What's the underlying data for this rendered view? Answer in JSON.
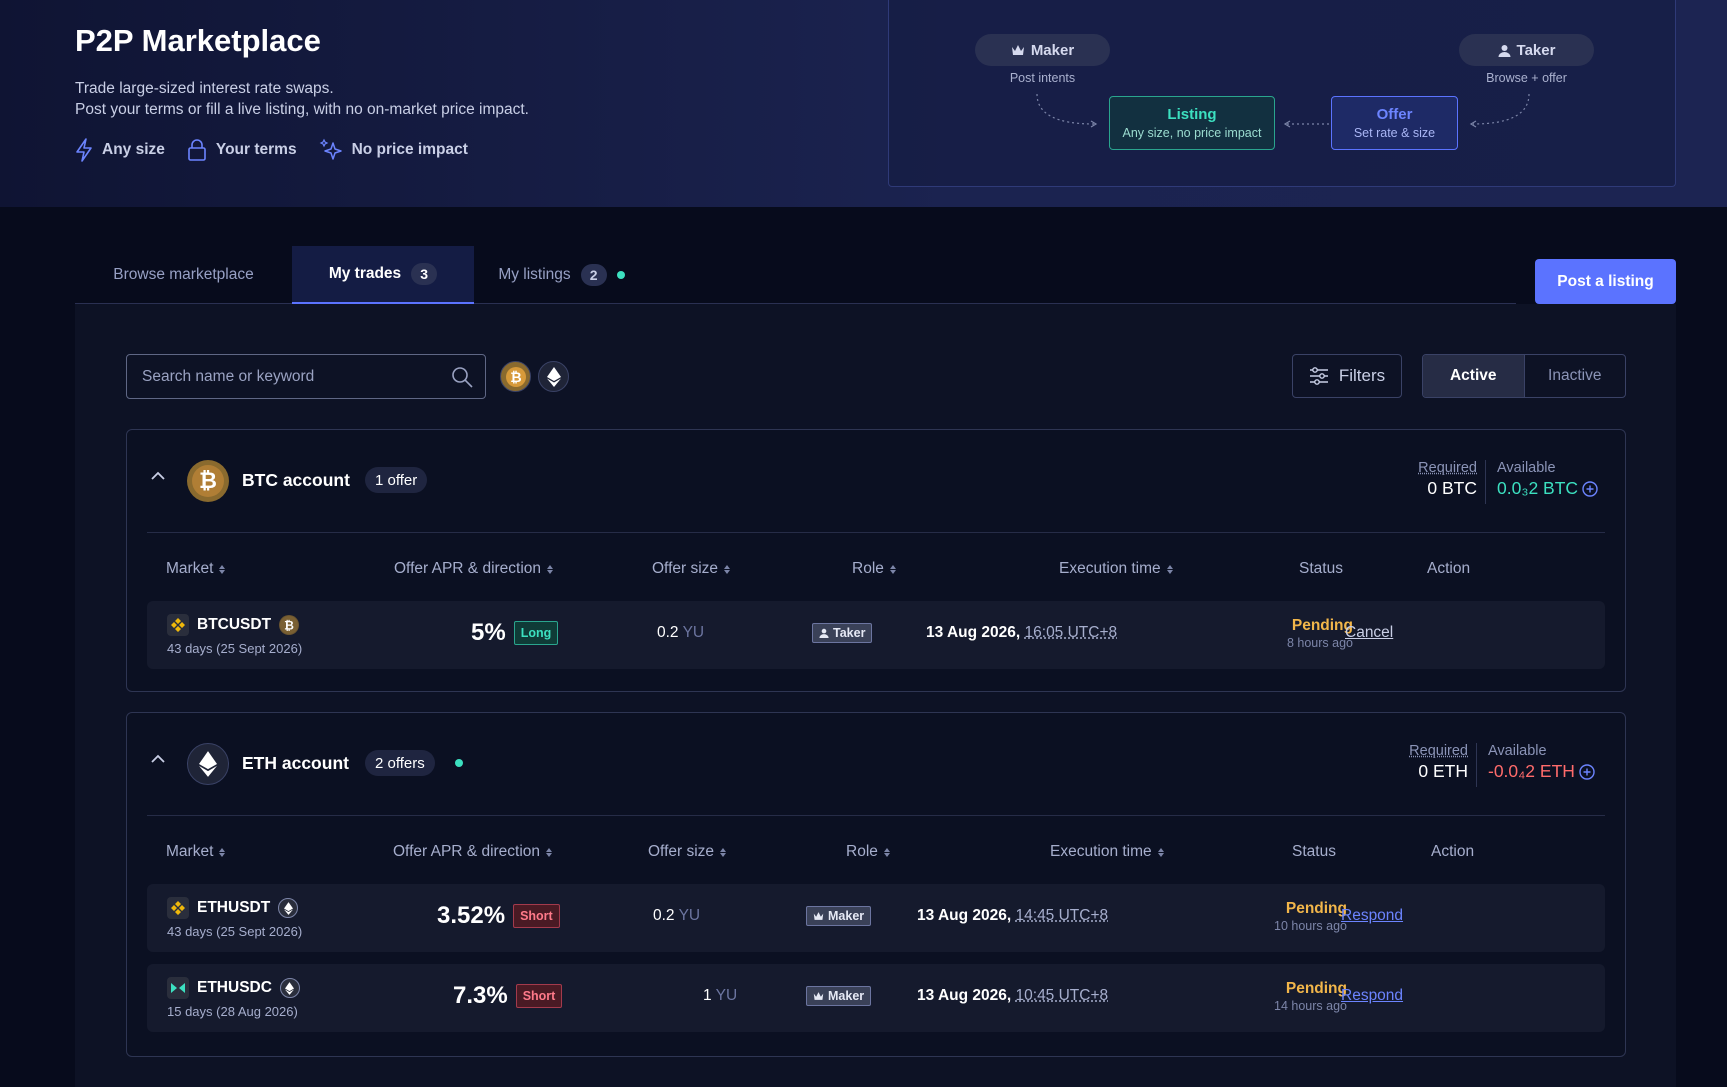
{
  "hero": {
    "title": "P2P Marketplace",
    "subtitle_line1": "Trade large-sized interest rate swaps.",
    "subtitle_line2": "Post your terms or fill a live listing, with no on-market price impact.",
    "features": [
      "Any size",
      "Your terms",
      "No price impact"
    ]
  },
  "flow": {
    "maker_label": "Maker",
    "maker_note": "Post intents",
    "taker_label": "Taker",
    "taker_note": "Browse + offer",
    "listing_title": "Listing",
    "listing_sub": "Any size, no price impact",
    "offer_title": "Offer",
    "offer_sub": "Set rate & size",
    "colors": {
      "listing": "#3ce0c0",
      "offer": "#6c84ff"
    }
  },
  "tabs": [
    {
      "label": "Browse marketplace"
    },
    {
      "label": "My trades",
      "count": "3"
    },
    {
      "label": "My listings",
      "count": "2"
    }
  ],
  "post_button": "Post a listing",
  "search": {
    "placeholder": "Search name or keyword"
  },
  "filters_label": "Filters",
  "segment": {
    "active": "Active",
    "inactive": "Inactive"
  },
  "columns": [
    "Market",
    "Offer APR & direction",
    "Offer size",
    "Role",
    "Execution time",
    "Status",
    "Action"
  ],
  "accounts": [
    {
      "name": "BTC account",
      "offers": "1 offer",
      "required_label": "Required",
      "required_value": "0 BTC",
      "available_label": "Available",
      "available_value": "0.0₃2 BTC",
      "available_color": "#3ce0c0",
      "rows": [
        {
          "market": "BTCUSDT",
          "term": "43 days (25 Sept 2026)",
          "apr": "5%",
          "direction": "Long",
          "size": "0.2",
          "unit": "YU",
          "role": "Taker",
          "date": "13 Aug 2026,",
          "time": "16:05 UTC+8",
          "status": "Pending",
          "ago": "8 hours ago",
          "action": "Cancel"
        }
      ]
    },
    {
      "name": "ETH account",
      "offers": "2 offers",
      "required_label": "Required",
      "required_value": "0 ETH",
      "available_label": "Available",
      "available_value": "-0.0₄2 ETH",
      "available_color": "#ff6b6b",
      "rows": [
        {
          "market": "ETHUSDT",
          "term": "43 days (25 Sept 2026)",
          "apr": "3.52%",
          "direction": "Short",
          "size": "0.2",
          "unit": "YU",
          "role": "Maker",
          "date": "13 Aug 2026,",
          "time": "14:45 UTC+8",
          "status": "Pending",
          "ago": "10 hours ago",
          "action": "Respond"
        },
        {
          "market": "ETHUSDC",
          "term": "15 days (28 Aug 2026)",
          "apr": "7.3%",
          "direction": "Short",
          "size": "1",
          "unit": "YU",
          "role": "Maker",
          "date": "13 Aug 2026,",
          "time": "10:45 UTC+8",
          "status": "Pending",
          "ago": "14 hours ago",
          "action": "Respond"
        }
      ]
    }
  ]
}
